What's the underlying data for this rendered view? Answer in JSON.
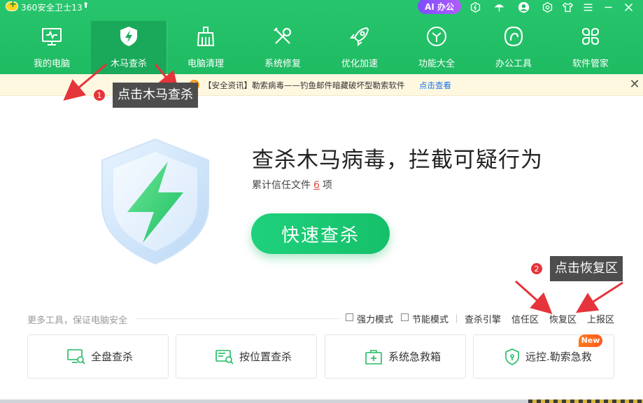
{
  "titlebar": {
    "app_title": "360安全卫士13",
    "ai_button": "AI 办公",
    "icons": [
      "upgrade-arrow-icon",
      "speed-icon",
      "umbrella-icon",
      "user-avatar-icon",
      "skin-icon",
      "shirt-icon",
      "menu-icon",
      "minimize-icon",
      "close-icon"
    ]
  },
  "nav": {
    "items": [
      {
        "label": "我的电脑",
        "icon": "monitor-icon"
      },
      {
        "label": "木马查杀",
        "icon": "shield-bolt-icon",
        "active": true
      },
      {
        "label": "电脑清理",
        "icon": "broom-icon"
      },
      {
        "label": "系统修复",
        "icon": "tools-icon"
      },
      {
        "label": "优化加速",
        "icon": "rocket-icon"
      },
      {
        "label": "功能大全",
        "icon": "cube-icon"
      },
      {
        "label": "办公工具",
        "icon": "office-icon"
      },
      {
        "label": "软件管家",
        "icon": "apps-icon"
      }
    ]
  },
  "notice": {
    "icon": "!",
    "text": "【安全资讯】勒索病毒——钓鱼邮件暗藏破坏型勒索软件",
    "link": "点击查看"
  },
  "hero": {
    "title": "查杀木马病毒，拦截可疑行为",
    "sub_prefix": "累计信任文件",
    "trust_count": "6",
    "sub_suffix": "项",
    "scan_button": "快速查杀"
  },
  "options": {
    "more_tools": "更多工具，保证电脑安全",
    "strong_mode": "强力模式",
    "power_save_mode": "节能模式",
    "engine": "查杀引擎",
    "trust_zone": "信任区",
    "restore_zone": "恢复区",
    "report_zone": "上报区"
  },
  "tools": [
    {
      "label": "全盘查杀",
      "icon": "full-scan-icon"
    },
    {
      "label": "按位置查杀",
      "icon": "location-scan-icon"
    },
    {
      "label": "系统急救箱",
      "icon": "first-aid-kit-icon"
    },
    {
      "label": "远控.勒索急救",
      "icon": "shield-lock-icon",
      "badge": "New"
    }
  ],
  "annotations": {
    "step1_num": "1",
    "step1_text": "点击木马查杀",
    "step2_num": "2",
    "step2_text": "点击恢复区"
  },
  "colors": {
    "brand_green": "#1fbb62",
    "active_tab": "#1aa95a",
    "scan_button": "#1fd17c",
    "notice_bg": "#fff8e1",
    "link_blue": "#1a73e8",
    "callout_bg": "#4d4d4d",
    "callout_num": "#e5343b",
    "arrow_red": "#e5343b",
    "badge_orange": "#ff6a1f"
  }
}
